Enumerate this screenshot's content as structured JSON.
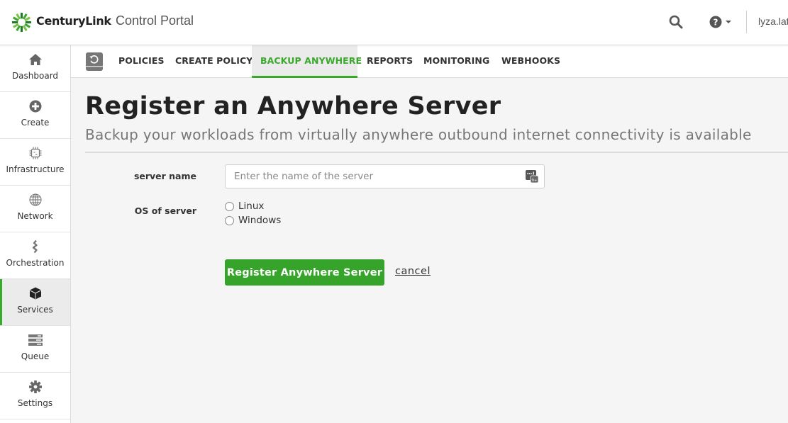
{
  "header": {
    "brand_name": "CenturyLink",
    "app_title": "Control Portal",
    "user_name": "lyza.latham",
    "search_icon": "search-icon",
    "help_icon": "question-circle-icon"
  },
  "sidebar": {
    "items": [
      {
        "label": "Dashboard",
        "icon": "home-icon",
        "active": false
      },
      {
        "label": "Create",
        "icon": "plus-circle-icon",
        "active": false
      },
      {
        "label": "Infrastructure",
        "icon": "chip-icon",
        "active": false
      },
      {
        "label": "Network",
        "icon": "globe-icon",
        "active": false
      },
      {
        "label": "Orchestration",
        "icon": "orchestration-icon",
        "active": false
      },
      {
        "label": "Services",
        "icon": "cube-icon",
        "active": true
      },
      {
        "label": "Queue",
        "icon": "queue-icon",
        "active": false
      },
      {
        "label": "Settings",
        "icon": "gear-icon",
        "active": false
      }
    ]
  },
  "tabs": {
    "icon": "backup-icon",
    "items": [
      {
        "label": "POLICIES",
        "active": false
      },
      {
        "label": "CREATE POLICY",
        "active": false
      },
      {
        "label": "BACKUP ANYWHERE",
        "active": true
      },
      {
        "label": "REPORTS",
        "active": false
      },
      {
        "label": "MONITORING",
        "active": false
      },
      {
        "label": "WEBHOOKS",
        "active": false
      }
    ]
  },
  "page": {
    "title": "Register an Anywhere Server",
    "subtitle": "Backup your workloads from virtually anywhere outbound internet connectivity is available"
  },
  "form": {
    "server_name_label": "server name",
    "server_name_value": "",
    "server_name_placeholder": "Enter the name of the server",
    "os_label": "OS of server",
    "os_options": [
      "Linux",
      "Windows"
    ],
    "os_selected": null,
    "submit_label": "Register Anywhere Server",
    "cancel_label": "cancel"
  },
  "colors": {
    "accent_green": "#3aa82d",
    "button_green": "#36a42a",
    "active_bg": "#ebebeb"
  }
}
